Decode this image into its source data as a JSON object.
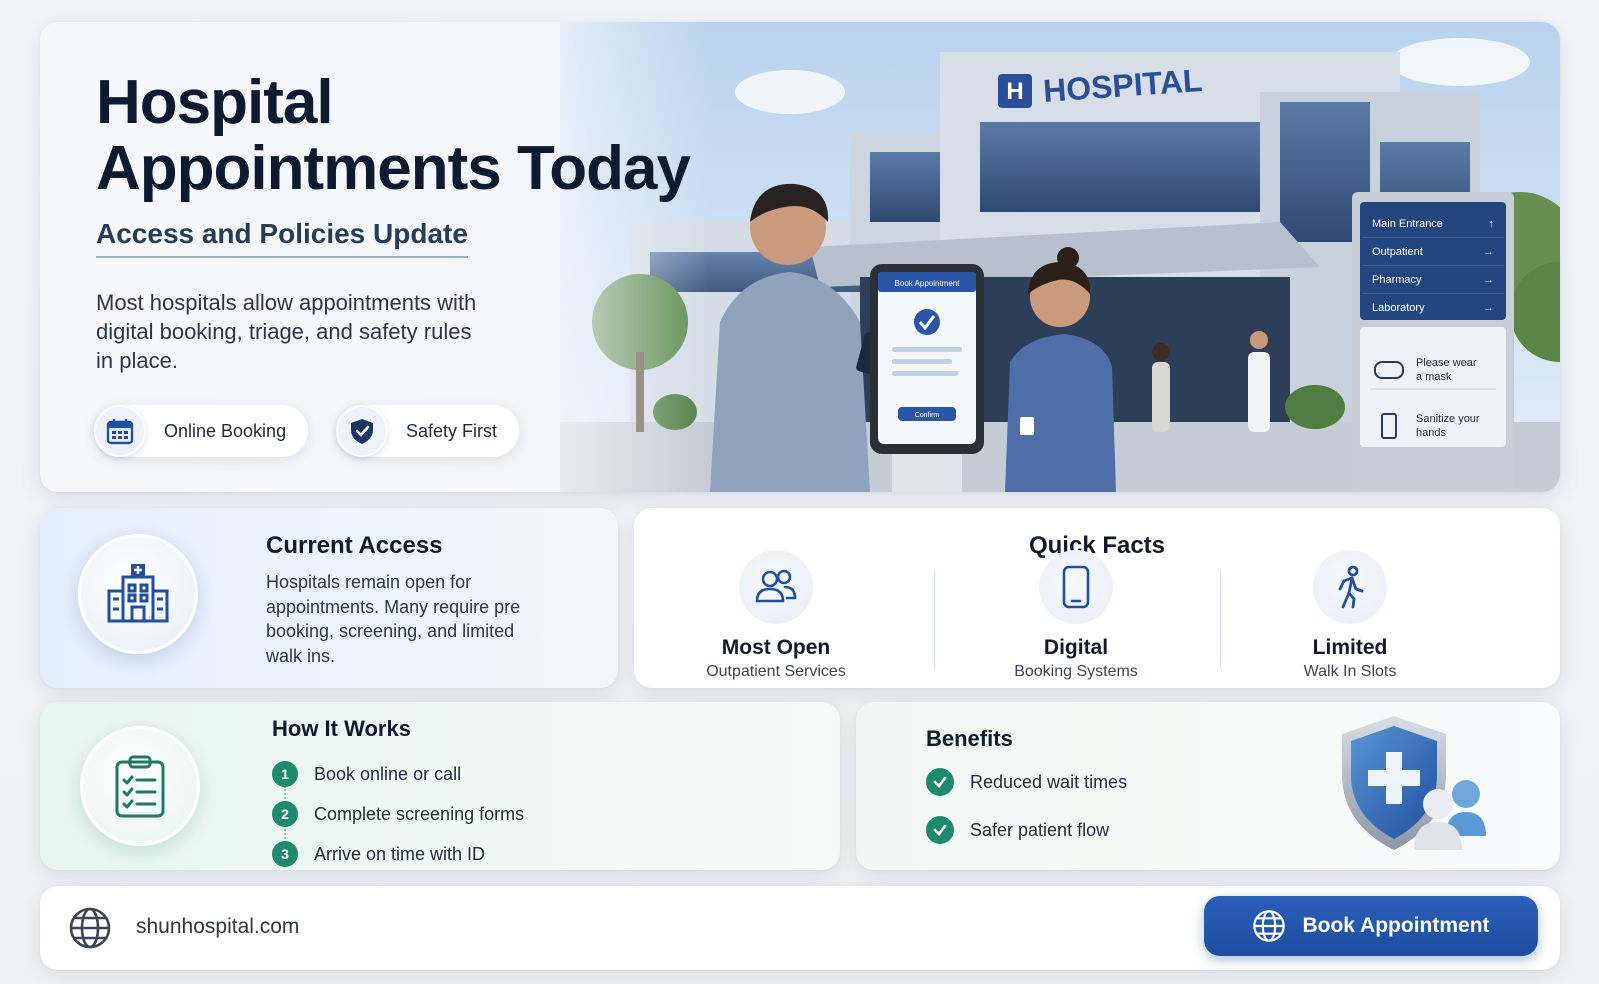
{
  "hero": {
    "title_line1": "Hospital",
    "title_line2": "Appointments Today",
    "subtitle": "Access and Policies Update",
    "description": "Most hospitals allow appointments with digital booking, triage, and safety rules in place.",
    "pills": [
      {
        "label": "Online Booking",
        "icon": "calendar-icon"
      },
      {
        "label": "Safety First",
        "icon": "shield-check-icon"
      }
    ],
    "scene": {
      "building_sign": "HOSPITAL",
      "building_sign_letter": "H",
      "kiosk_header": "Book Appointment",
      "kiosk_button": "Confirm",
      "wayfinding": [
        {
          "label": "Main Entrance",
          "arrow": "↑"
        },
        {
          "label": "Outpatient",
          "arrow": "→"
        },
        {
          "label": "Pharmacy",
          "arrow": "→"
        },
        {
          "label": "Laboratory",
          "arrow": "→"
        }
      ],
      "notices": [
        {
          "line1": "Please wear",
          "line2": "a mask",
          "icon": "mask-icon"
        },
        {
          "line1": "Sanitize your",
          "line2": "hands",
          "icon": "sanitizer-icon"
        }
      ]
    }
  },
  "access": {
    "title": "Current Access",
    "text": "Hospitals remain open for appointments. Many require pre booking, screening, and limited walk ins.",
    "icon": "hospital-building-icon"
  },
  "facts": {
    "title": "Quick Facts",
    "items": [
      {
        "title": "Most Open",
        "subtitle": "Outpatient Services",
        "icon": "people-icon"
      },
      {
        "title": "Digital",
        "subtitle": "Booking Systems",
        "icon": "smartphone-icon"
      },
      {
        "title": "Limited",
        "subtitle": "Walk In Slots",
        "icon": "walking-person-icon"
      }
    ]
  },
  "how": {
    "title": "How It Works",
    "icon": "clipboard-checklist-icon",
    "steps": [
      {
        "num": "1",
        "text": "Book online or call"
      },
      {
        "num": "2",
        "text": "Complete screening forms"
      },
      {
        "num": "3",
        "text": "Arrive on time with ID"
      }
    ]
  },
  "benefits": {
    "title": "Benefits",
    "items": [
      "Reduced wait times",
      "Safer patient flow"
    ],
    "icon": "shield-patient-icon"
  },
  "footer": {
    "site": "shunhospital.com",
    "button": "Book Appointment"
  },
  "colors": {
    "primary": "#1d4d9f",
    "green": "#1d8a6d",
    "text": "#0f1b2d"
  }
}
